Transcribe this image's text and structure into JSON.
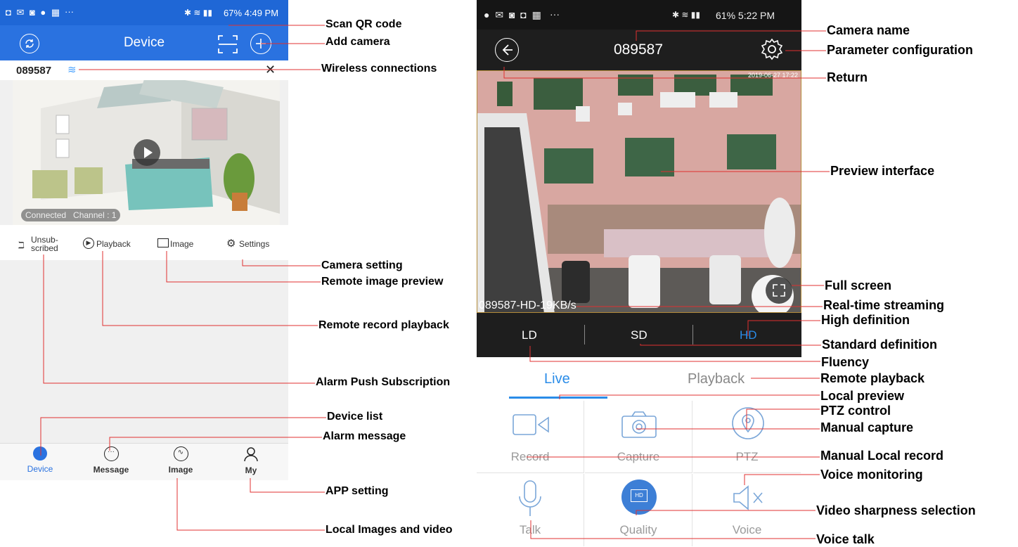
{
  "left_phone": {
    "status": {
      "icons_text": "···",
      "right": "67% 4:49 PM"
    },
    "header": {
      "title": "Device"
    },
    "device": {
      "name": "089587"
    },
    "card": {
      "status_text": "Connected   Channel : 1"
    },
    "actions": [
      {
        "label": "Unsub-\nscribed"
      },
      {
        "label": "Playback"
      },
      {
        "label": "Image"
      },
      {
        "label": "Settings"
      }
    ],
    "tabs": [
      {
        "label": "Device"
      },
      {
        "label": "Message"
      },
      {
        "label": "Image"
      },
      {
        "label": "My"
      }
    ]
  },
  "right_phone": {
    "status": {
      "icons_text": "···",
      "right": "61% 5:22 PM"
    },
    "header": {
      "title": "089587"
    },
    "preview": {
      "timestamp": "2019-06-27 17:22",
      "stream_text": "089587-HD-19KB/s"
    },
    "quality": [
      {
        "label": "LD"
      },
      {
        "label": "SD"
      },
      {
        "label": "HD"
      }
    ],
    "mode_tabs": [
      {
        "label": "Live"
      },
      {
        "label": "Playback"
      }
    ],
    "grid": [
      {
        "label": "Record"
      },
      {
        "label": "Capture"
      },
      {
        "label": "PTZ"
      },
      {
        "label": "Talk"
      },
      {
        "label": "Quality"
      },
      {
        "label": "Voice"
      }
    ],
    "quality_badge": "HD"
  },
  "annotations_left": {
    "scan_qr": "Scan QR code",
    "add_camera": "Add camera",
    "wireless": "Wireless connections",
    "camera_setting": "Camera setting",
    "remote_image": "Remote image preview",
    "remote_record": "Remote record playback",
    "alarm_push": "Alarm Push Subscription",
    "device_list": "Device list",
    "alarm_message": "Alarm message",
    "app_setting": "APP setting",
    "local_images": "Local Images and video"
  },
  "annotations_right": {
    "camera_name": "Camera name",
    "param_config": "Parameter configuration",
    "return": "Return",
    "preview_interface": "Preview interface",
    "full_screen": "Full screen",
    "realtime": "Real-time streaming",
    "high_def": "High definition",
    "standard_def": "Standard definition",
    "fluency": "Fluency",
    "remote_playback": "Remote playback",
    "local_preview": "Local preview",
    "ptz_control": "PTZ control",
    "manual_capture": "Manual capture",
    "manual_record": "Manual Local record",
    "voice_monitoring": "Voice monitoring",
    "sharpness": "Video sharpness selection",
    "voice_talk": "Voice talk"
  },
  "colors": {
    "blue": "#2a72e0",
    "hd_active": "#2a8ce8",
    "callout_line": "#e03030"
  }
}
